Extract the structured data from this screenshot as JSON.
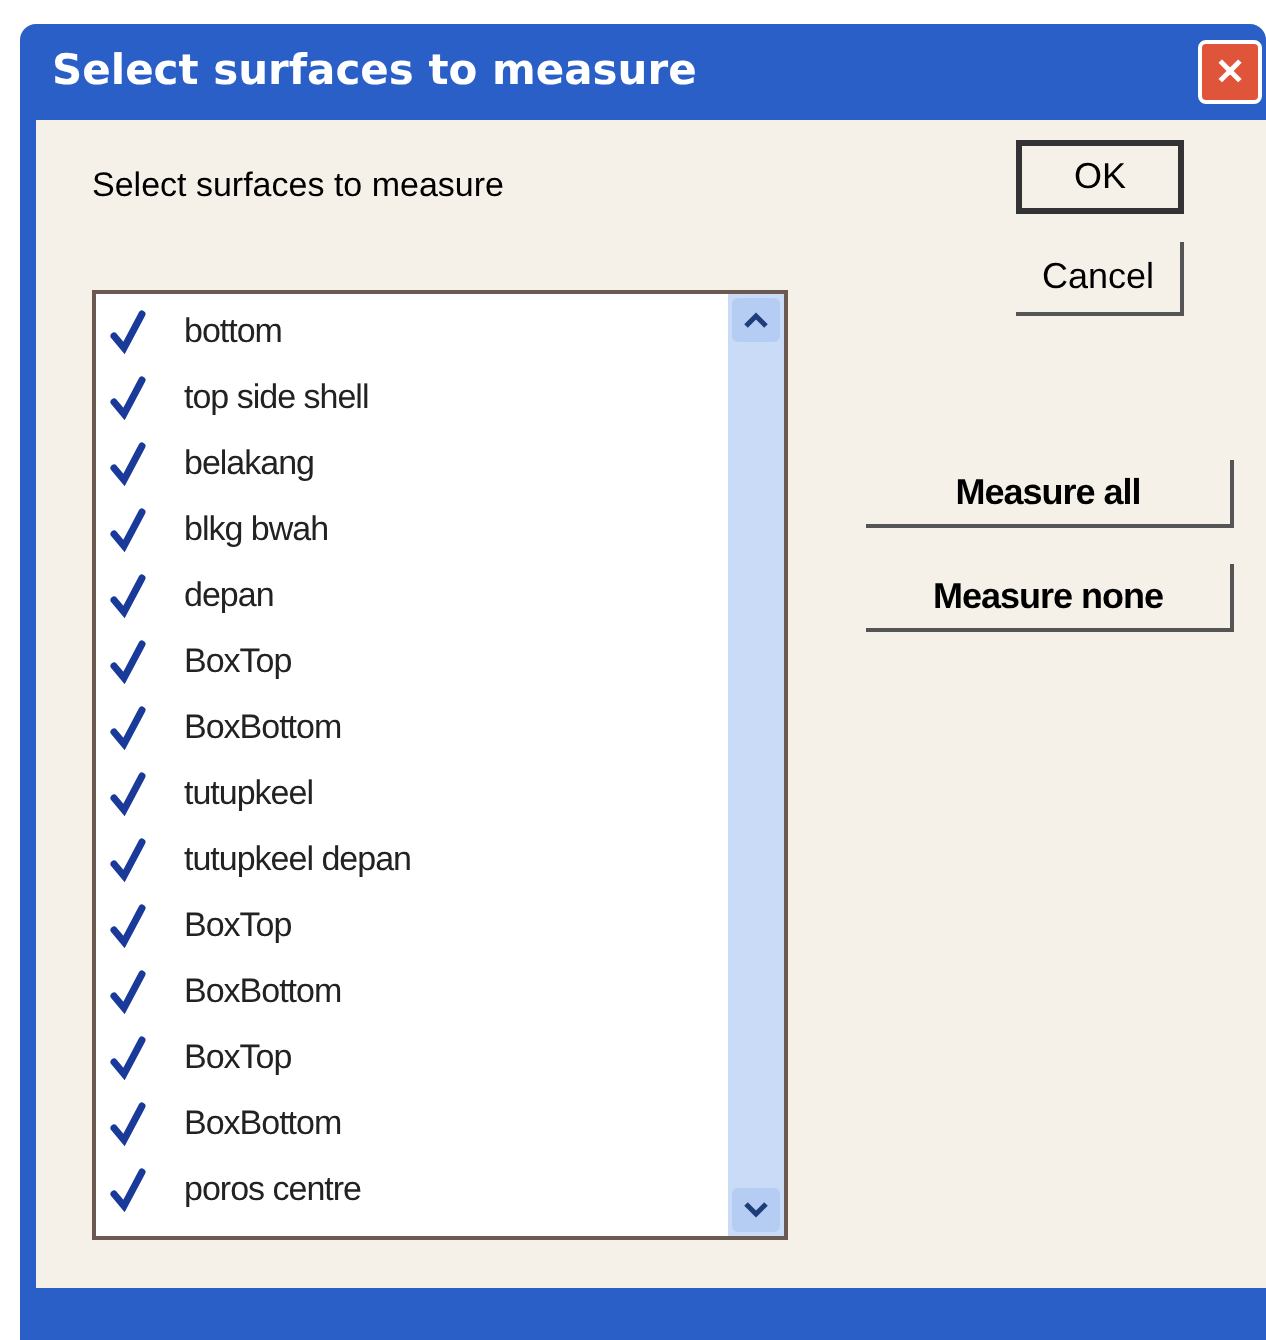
{
  "window": {
    "title": "Select surfaces to measure",
    "close_button": "✕"
  },
  "prompt": "Select surfaces to measure",
  "surfaces": [
    {
      "label": "bottom",
      "checked": true
    },
    {
      "label": "top side shell",
      "checked": true
    },
    {
      "label": "belakang",
      "checked": true
    },
    {
      "label": "blkg bwah",
      "checked": true
    },
    {
      "label": "depan",
      "checked": true
    },
    {
      "label": "BoxTop",
      "checked": true
    },
    {
      "label": "BoxBottom",
      "checked": true
    },
    {
      "label": "tutupkeel",
      "checked": true
    },
    {
      "label": "tutupkeel depan",
      "checked": true
    },
    {
      "label": "BoxTop",
      "checked": true
    },
    {
      "label": "BoxBottom",
      "checked": true
    },
    {
      "label": "BoxTop",
      "checked": true
    },
    {
      "label": "BoxBottom",
      "checked": true
    },
    {
      "label": "poros centre",
      "checked": true
    }
  ],
  "buttons": [
    {
      "label": "OK",
      "default": true
    },
    {
      "label": "Cancel",
      "default": false
    }
  ],
  "measure_buttons": [
    "Measure all",
    "Measure none"
  ]
}
